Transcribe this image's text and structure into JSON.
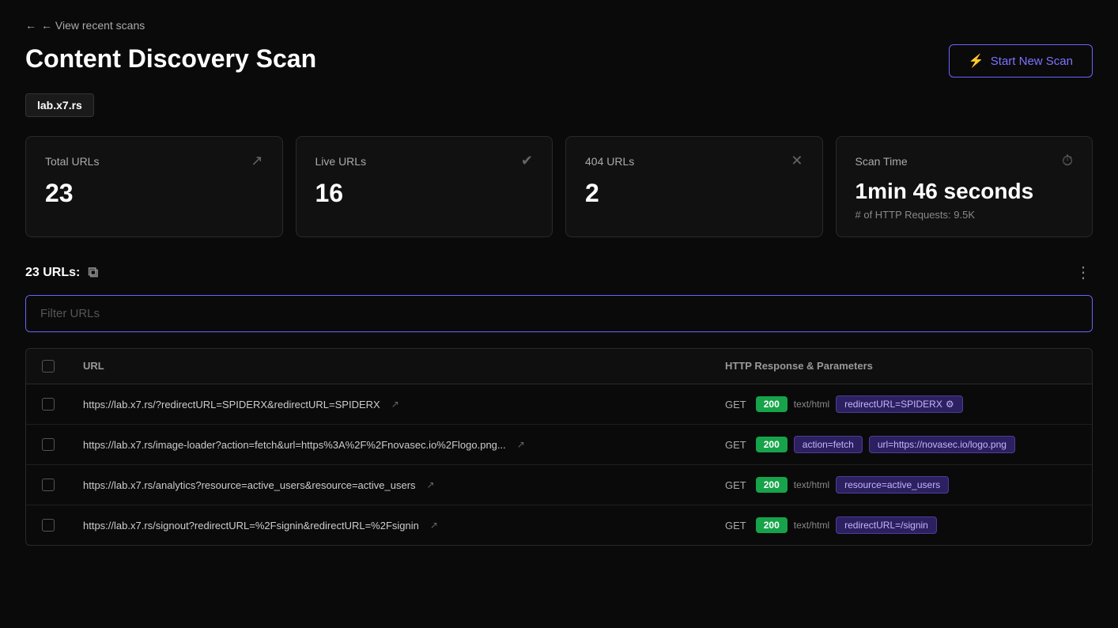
{
  "nav": {
    "back_label": "← View recent scans"
  },
  "page": {
    "title": "Content Discovery Scan",
    "domain": "lab.x7.rs"
  },
  "header": {
    "start_scan_label": "Start New Scan"
  },
  "stats": [
    {
      "label": "Total URLs",
      "value": "23",
      "icon": "external-link",
      "sub": null
    },
    {
      "label": "Live URLs",
      "value": "16",
      "icon": "check-circle",
      "sub": null
    },
    {
      "label": "404 URLs",
      "value": "2",
      "icon": "x-circle",
      "sub": null
    },
    {
      "label": "Scan Time",
      "value": "1min 46 seconds",
      "icon": "clock",
      "sub": "# of HTTP Requests: 9.5K"
    }
  ],
  "urls_section": {
    "count_label": "23 URLs:"
  },
  "filter": {
    "placeholder": "Filter URLs"
  },
  "table": {
    "columns": [
      "URL",
      "HTTP Response & Parameters"
    ],
    "rows": [
      {
        "url": "https://lab.x7.rs/?redirectURL=SPIDERX&redirectURL=SPIDERX",
        "method": "GET",
        "status": "200",
        "content_type": "text/html",
        "params": [
          "redirectURL=SPIDERX"
        ]
      },
      {
        "url": "https://lab.x7.rs/image-loader?action=fetch&url=https%3A%2F%2Fnovasec.io%2Flogo.png...",
        "method": "GET",
        "status": "200",
        "content_type": null,
        "params": [
          "action=fetch",
          "url=https://novasec.io/logo.png"
        ]
      },
      {
        "url": "https://lab.x7.rs/analytics?resource=active_users&resource=active_users",
        "method": "GET",
        "status": "200",
        "content_type": "text/html",
        "params": [
          "resource=active_users"
        ]
      },
      {
        "url": "https://lab.x7.rs/signout?redirectURL=%2Fsignin&redirectURL=%2Fsignin",
        "method": "GET",
        "status": "200",
        "content_type": "text/html",
        "params": [
          "redirectURL=/signin"
        ]
      }
    ]
  }
}
